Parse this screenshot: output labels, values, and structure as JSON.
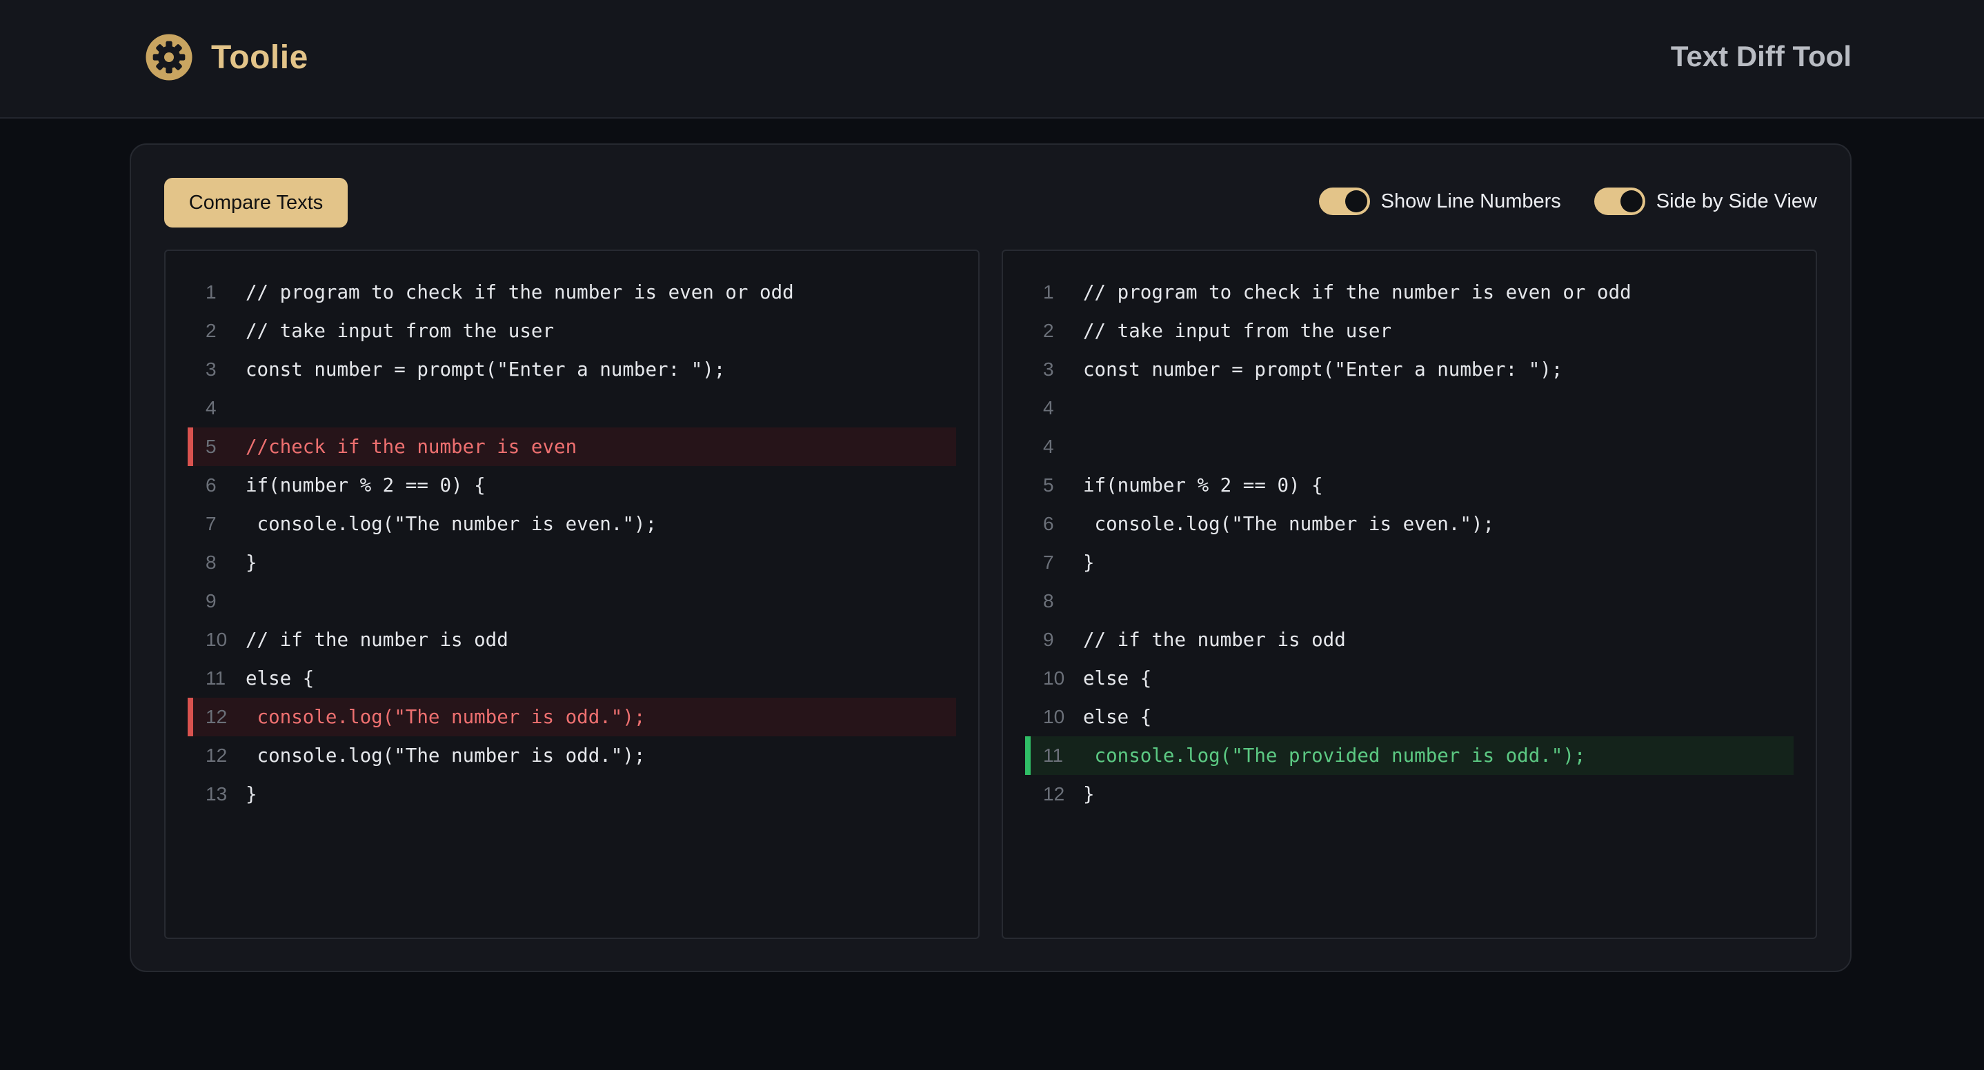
{
  "header": {
    "brand": "Toolie",
    "title": "Text Diff Tool"
  },
  "toolbar": {
    "compare_label": "Compare Texts",
    "show_line_numbers_label": "Show Line Numbers",
    "show_line_numbers_on": true,
    "side_by_side_label": "Side by Side View",
    "side_by_side_on": true
  },
  "colors": {
    "accent": "#e3c489",
    "removed": "#ee7070",
    "added": "#5cc983"
  },
  "left": {
    "lines": [
      {
        "num": "1",
        "text": "// program to check if the number is even or odd",
        "state": ""
      },
      {
        "num": "2",
        "text": "// take input from the user",
        "state": ""
      },
      {
        "num": "3",
        "text": "const number = prompt(\"Enter a number: \");",
        "state": ""
      },
      {
        "num": "4",
        "text": "",
        "state": ""
      },
      {
        "num": "5",
        "text": "//check if the number is even",
        "state": "removed"
      },
      {
        "num": "6",
        "text": "if(number % 2 == 0) {",
        "state": ""
      },
      {
        "num": "7",
        "text": " console.log(\"The number is even.\");",
        "state": ""
      },
      {
        "num": "8",
        "text": "}",
        "state": ""
      },
      {
        "num": "9",
        "text": "",
        "state": ""
      },
      {
        "num": "10",
        "text": "// if the number is odd",
        "state": ""
      },
      {
        "num": "11",
        "text": "else {",
        "state": ""
      },
      {
        "num": "12",
        "text": " console.log(\"The number is odd.\");",
        "state": "removed"
      },
      {
        "num": "12",
        "text": " console.log(\"The number is odd.\");",
        "state": ""
      },
      {
        "num": "13",
        "text": "}",
        "state": ""
      }
    ]
  },
  "right": {
    "lines": [
      {
        "num": "1",
        "text": "// program to check if the number is even or odd",
        "state": ""
      },
      {
        "num": "2",
        "text": "// take input from the user",
        "state": ""
      },
      {
        "num": "3",
        "text": "const number = prompt(\"Enter a number: \");",
        "state": ""
      },
      {
        "num": "4",
        "text": "",
        "state": ""
      },
      {
        "num": "4",
        "text": "",
        "state": ""
      },
      {
        "num": "5",
        "text": "if(number % 2 == 0) {",
        "state": ""
      },
      {
        "num": "6",
        "text": " console.log(\"The number is even.\");",
        "state": ""
      },
      {
        "num": "7",
        "text": "}",
        "state": ""
      },
      {
        "num": "8",
        "text": "",
        "state": ""
      },
      {
        "num": "9",
        "text": "// if the number is odd",
        "state": ""
      },
      {
        "num": "10",
        "text": "else {",
        "state": ""
      },
      {
        "num": "10",
        "text": "else {",
        "state": ""
      },
      {
        "num": "11",
        "text": " console.log(\"The provided number is odd.\");",
        "state": "added"
      },
      {
        "num": "12",
        "text": "}",
        "state": ""
      }
    ]
  }
}
